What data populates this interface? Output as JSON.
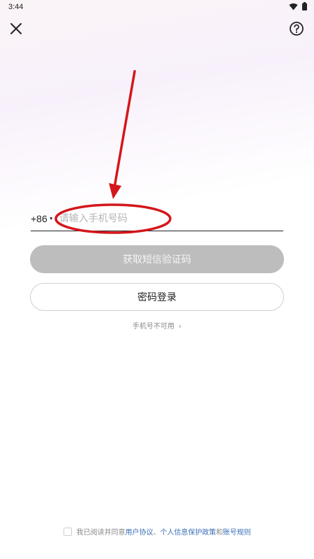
{
  "status_bar": {
    "time": "3:44",
    "wifi_icon": "wifi-icon",
    "battery_icon": "battery-icon"
  },
  "toolbar": {
    "close_icon": "close-icon",
    "help_icon": "help-icon"
  },
  "login": {
    "country_code": "+86",
    "phone_placeholder": "请输入手机号码",
    "phone_value": "",
    "get_code_label": "获取短信验证码",
    "password_login_label": "密码登录",
    "phone_unavailable_label": "手机号不可用",
    "phone_unavailable_arrow": "›"
  },
  "agreement": {
    "prefix": "我已阅读并同意",
    "user_agreement": "用户协议",
    "separator": "、",
    "privacy_policy": "个人信息保护政策",
    "and": "和",
    "account_rules": "账号规则",
    "checked": false
  },
  "annotation": {
    "color": "#d4161b"
  },
  "colors": {
    "button_disabled": "#bdbdbd",
    "link": "#3a6fb8"
  }
}
